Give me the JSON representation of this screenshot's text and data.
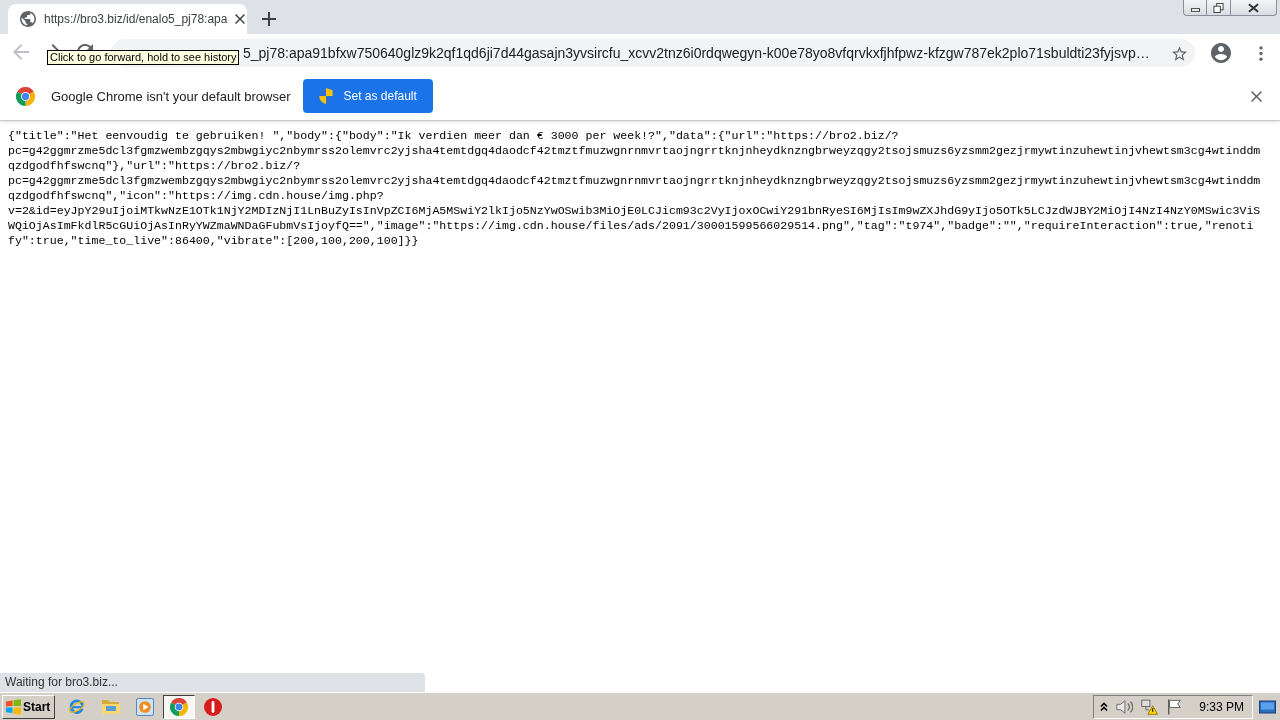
{
  "browser": {
    "tabs": [
      {
        "title": "https://bro3.biz/id/enalo5_pj78:apa",
        "selected": true
      }
    ],
    "nav_buttons": [
      {
        "kind": "back",
        "disabled": true
      },
      {
        "kind": "forward",
        "disabled": false
      },
      {
        "kind": "reload",
        "disabled": false
      }
    ],
    "address_bar": {
      "url": "5_pj78:apa91bfxw750640glz9k2qf1qd6ji7d44gasajn3yvsircfu_xcvv2tnz6i0rdqwegyn-k00e78yo8vfqrvkxfjhfpwz-kfzgw787ek2plo71sbuldti23fyjsvp…"
    },
    "tooltip": "Click to go forward, hold to see history",
    "infobar": {
      "message": "Google Chrome isn't your default browser",
      "button": "Set as default"
    },
    "status_bubble": "Waiting for bro3.biz..."
  },
  "page": {
    "lines": [
      "{\"title\":\"Het eenvoudig te gebruiken! \",\"body\":{\"body\":\"Ik verdien meer dan € 3000 per week!?\",\"data\":{\"url\":\"https://bro2.biz/?",
      "pc=g42ggmrzme5dcl3fgmzwembzgqys2mbwgiyc2nbymrss2olemvrc2yjsha4temtdgq4daodcf42tmztfmuzwgnrnmvrtaojngrrtknjnheydknzngbrweyzqgy2tsojsmuzs6yzsmm2gezjrmywtinzuhewtinjvhewtsm3cg4wtinddm",
      "qzdgodfhfswcnq\"},\"url\":\"https://bro2.biz/?",
      "pc=g42ggmrzme5dcl3fgmzwembzgqys2mbwgiyc2nbymrss2olemvrc2yjsha4temtdgq4daodcf42tmztfmuzwgnrnmvrtaojngrrtknjnheydknzngbrweyzqgy2tsojsmuzs6yzsmm2gezjrmywtinzuhewtinjvhewtsm3cg4wtinddm",
      "qzdgodfhfswcnq\",\"icon\":\"https://img.cdn.house/img.php?",
      "v=2&id=eyJpY29uIjoiMTkwNzE1OTk1NjY2MDIzNjI1LnBuZyIsInVpZCI6MjA5MSwiY2lkIjo5NzYwOSwib3MiOjE0LCJicm93c2VyIjoxOCwiY291bnRyeSI6MjIsIm9wZXJhdG9yIjo5OTk5LCJzdWJBY2MiOjI4NzI4NzY0MSwic3ViS",
      "WQiOjAsImFkdlR5cGUiOjAsInRyYWZmaWNDaGFubmVsIjoyfQ==\",\"image\":\"https://img.cdn.house/files/ads/2091/30001599566029514.png\",\"tag\":\"t974\",\"badge\":\"\",\"requireInteraction\":true,\"renoti",
      "fy\":true,\"time_to_live\":86400,\"vibrate\":[200,100,200,100]}}"
    ]
  },
  "taskbar": {
    "start_label": "Start",
    "apps": [
      {
        "kind": "browser",
        "selected": false
      },
      {
        "kind": "folder",
        "selected": false
      },
      {
        "kind": "media",
        "selected": false
      },
      {
        "kind": "chrome",
        "selected": true
      },
      {
        "kind": "alert",
        "selected": false
      }
    ],
    "clock": "9:33 PM"
  }
}
